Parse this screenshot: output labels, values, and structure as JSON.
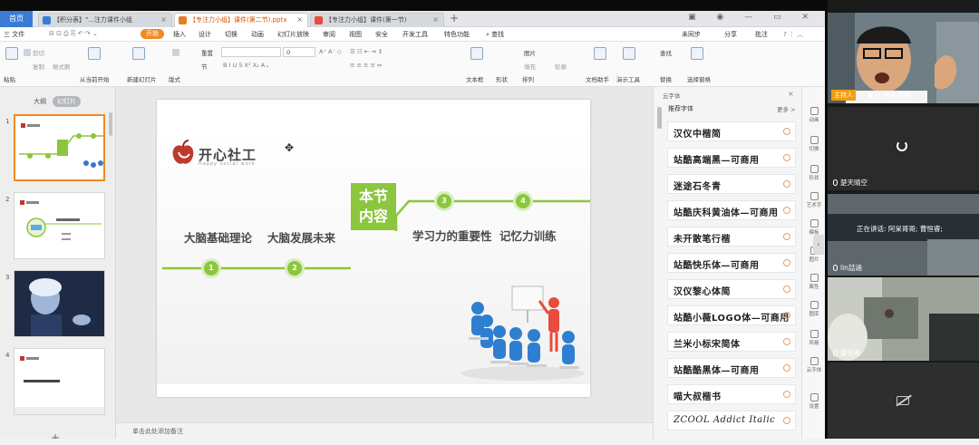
{
  "window": {
    "home_tab": "首页",
    "tabs": [
      {
        "label": "【积分表】\"...注力课件小组",
        "color": "#3a7bd5"
      },
      {
        "label": "【专注力小组】课件(第二节).pptx",
        "color": "#e67e22"
      },
      {
        "label": "【专注力小组】课件(第一节)",
        "color": "#e74c3c"
      }
    ],
    "add_tab": "+"
  },
  "menu": {
    "file": "三 文件",
    "items": [
      "开始",
      "插入",
      "设计",
      "切换",
      "动画",
      "幻灯片放映",
      "审阅",
      "视图",
      "安全",
      "开发工具",
      "特色功能"
    ],
    "search": "查找",
    "right": [
      "未同步",
      "分享",
      "批注"
    ]
  },
  "ribbon": {
    "paste": "粘贴",
    "cut": "剪切",
    "copy": "复制",
    "format_painter": "格式刷",
    "from_current": "从当前开始",
    "new_slide": "新建幻灯片",
    "layout": "版式",
    "section": "节",
    "reset": "重置",
    "font_size": "0",
    "textbox": "文本框",
    "shape": "形状",
    "arrange": "排列",
    "picture": "图片",
    "fill": "填充",
    "outline": "轮廓",
    "find": "查找",
    "replace": "替换",
    "select": "选择",
    "text_tools": "文档助手",
    "presentation_tools": "演示工具",
    "select_pane": "选择窗格"
  },
  "left_panel": {
    "tab_outline": "大纲",
    "tab_slides": "幻灯片",
    "slide_numbers": [
      "1",
      "2",
      "3",
      "4"
    ],
    "add_slide": "+"
  },
  "slide": {
    "logo_text": "开心社工",
    "logo_sub": "Happy social work",
    "topics": [
      "大脑基础理论",
      "大脑发展未来",
      "学习力的重要性",
      "记忆力训练"
    ],
    "center_line1": "本节",
    "center_line2": "内容",
    "node_numbers": [
      "1",
      "2",
      "3",
      "4"
    ],
    "accent": "#8cc63f"
  },
  "notes_hint": "单击此处添加备注",
  "font_panel": {
    "title": "云字体",
    "subtitle": "推荐字体",
    "more": "更多 >",
    "fonts": [
      "汉仪中楷简",
      "站酷高端黑—可商用",
      "迷途石冬青",
      "站酷庆科黄油体—可商用",
      "未开散笔行楷",
      "站酷快乐体—可商用",
      "汉仪黎心体简",
      "站酷小薇LOGO体—可商用",
      "兰米小标宋简体",
      "站酷酷黑体—可商用",
      "喵大叔楷书",
      "ZCOOL Addict Italic"
    ]
  },
  "side_tools": [
    "动画",
    "切换",
    "形状",
    "艺术字",
    "模板",
    "图片",
    "属性",
    "图库",
    "风格",
    "云字体",
    "设置"
  ],
  "video": {
    "host_badge": "主持人",
    "host_name": "阿呆哥哥",
    "tile2_name": "楚天晴空",
    "speaking_text": "正在讲话: 阿呆哥哥; 曹恒睿;",
    "tile3_name": "lin喆涵",
    "tile4_name": "曹恒睿"
  }
}
